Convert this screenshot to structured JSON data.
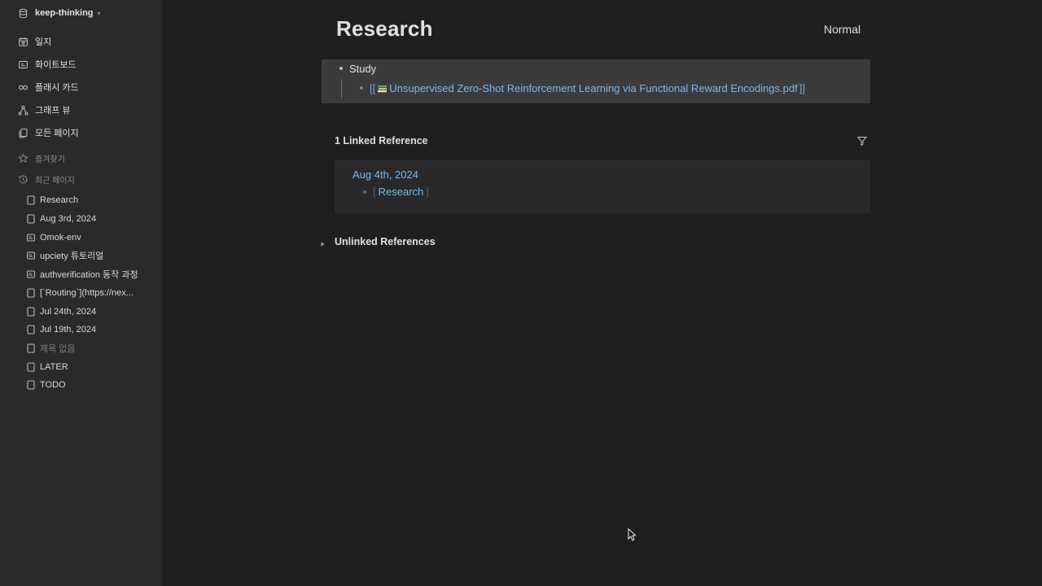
{
  "sidebar": {
    "graph_name": "keep-thinking",
    "nav": [
      {
        "label": "일지",
        "icon": "calendar-icon"
      },
      {
        "label": "화이트보드",
        "icon": "whiteboard-icon"
      },
      {
        "label": "플래시 카드",
        "icon": "infinity-icon"
      },
      {
        "label": "그래프 뷰",
        "icon": "graph-icon"
      },
      {
        "label": "모든 페이지",
        "icon": "pages-icon"
      }
    ],
    "favorites_label": "즐겨찾기",
    "recent_label": "최근 페이지",
    "recent": [
      {
        "label": "Research",
        "icon": "page-icon"
      },
      {
        "label": "Aug 3rd, 2024",
        "icon": "page-icon"
      },
      {
        "label": "Omok-env",
        "icon": "whiteboard-icon"
      },
      {
        "label": "upciety 튜토리얼",
        "icon": "whiteboard-icon"
      },
      {
        "label": "authverification 동작 과정",
        "icon": "whiteboard-icon"
      },
      {
        "label": "[`Routing`](https://nex...",
        "icon": "page-icon"
      },
      {
        "label": "Jul 24th, 2024",
        "icon": "page-icon"
      },
      {
        "label": "Jul 19th, 2024",
        "icon": "page-icon"
      },
      {
        "label": "제목 없음",
        "icon": "page-icon"
      },
      {
        "label": "LATER",
        "icon": "page-icon"
      },
      {
        "label": "TODO",
        "icon": "page-icon"
      }
    ]
  },
  "page": {
    "title": "Research",
    "mode": "Normal",
    "blocks": {
      "parent": "Study",
      "child_open": "[[",
      "child_link": "Unsupervised Zero-Shot Reinforcement Learning via Functional Reward Encodings.pdf",
      "child_close": "]]"
    },
    "linked": {
      "title": "1 Linked Reference",
      "date": "Aug 4th, 2024",
      "ref_open": "[",
      "ref_link": "Research",
      "ref_close": "]"
    },
    "unlinked_title": "Unlinked References"
  },
  "colors": {
    "background": "#1f1f21",
    "sidebar": "#2a2a2c",
    "link": "#7fb7ea",
    "block_highlight": "#3b3b3d"
  }
}
